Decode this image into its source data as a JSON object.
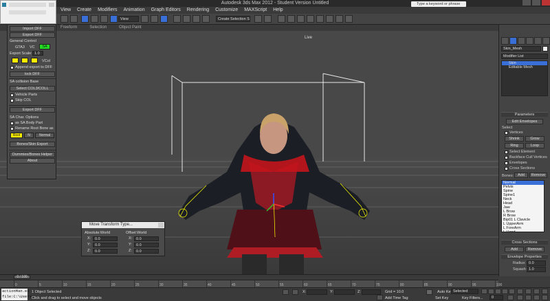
{
  "window": {
    "title": "Autodesk 3ds Max 2012 - Student Version   Untitled"
  },
  "menu": [
    "View",
    "Create",
    "Modifiers",
    "Animation",
    "Graph Editors",
    "Rendering",
    "Customize",
    "MAXScript",
    "Help"
  ],
  "toolbar": {
    "view_select": "View",
    "selection_set": "Create Selection S",
    "search_placeholder": "Type a keyword or phrase"
  },
  "ribbon": [
    "Freeform",
    "Selection",
    "Object Paint"
  ],
  "viewport": {
    "label": "Live"
  },
  "floater": {
    "buttons": {
      "import": "Import DFF",
      "export": "Export DFF",
      "lock": "lock DFF",
      "select_col": "Select COL3/COLL",
      "export2": "Export DFF",
      "bones_export": "Bones/Skin Export",
      "dummies": "Dummies/Bones Helper",
      "about": "About"
    },
    "general_control": "General Control",
    "gta_labels": [
      "GTA3",
      "VC",
      "SA"
    ],
    "export_scale_label": "Export Scale:",
    "export_scale_value": "1.0",
    "vcol_label": "VCol",
    "append": "Append export to DFF",
    "sa_collision": "SA collision Base",
    "vehicle_parts": "Vehicle Parts",
    "skip_col": "Skip COL",
    "sa_char": "SA Char. Options",
    "as_body": "as SA Body Part",
    "rename_root": "Rename Root Bone as",
    "root_fields": [
      "Root",
      "N",
      "Normal"
    ]
  },
  "transform": {
    "title": "Move Transform Type...",
    "absolute": "Absolute:World",
    "offset": "Offset:World",
    "axes": [
      "X:",
      "Y:",
      "Z:"
    ],
    "values": [
      "0.0",
      "0.0",
      "0.0"
    ]
  },
  "command_panel": {
    "object_name": "Skin_Mesh",
    "modifier_list": "Modifier List",
    "stack": [
      "Skin",
      "Editable Mesh"
    ],
    "parameters": "Parameters",
    "edit_envelopes": "Edit Envelopes",
    "select": "Select",
    "vertices": "Vertices",
    "buttons": [
      "Shrink",
      "Grow",
      "Ring",
      "Loop"
    ],
    "select_element": "Select Element",
    "backface": "Backface Cull Vertices",
    "envelopes": "Envelopes",
    "cross_sections": "Cross Sections",
    "bones_label": "Bones:",
    "add": "Add",
    "remove": "Remove",
    "bones": [
      "Normal",
      "Pelvis",
      "Spine",
      "Spine1",
      "Neck",
      "Head",
      "Jaw",
      "L Brow",
      "R Brow",
      "Bip01 L Clavicle",
      "L UpperArm",
      "L ForeArm",
      "L Hand",
      "L Finger"
    ],
    "cross_sections_title": "Cross Sections",
    "cs_add": "Add",
    "cs_remove": "Remove",
    "envelope_props": "Envelope Properties",
    "radius": "Radius:",
    "squash": "Squash:",
    "radius_value": "0.0",
    "squash_value": "1.0"
  },
  "timeline": {
    "slider": "0 / 100",
    "ticks": [
      "0",
      "5",
      "10",
      "15",
      "20",
      "25",
      "30",
      "35",
      "40",
      "45",
      "50",
      "55",
      "60",
      "65",
      "70",
      "75",
      "80",
      "85",
      "90",
      "95",
      "100"
    ]
  },
  "status": {
    "script_line1": "actionMan.ex",
    "script_line2": "file:C:\\Users",
    "selected": "1 Object Selected",
    "prompt": "Click and drag to select and move objects",
    "coords": [
      "X:",
      "Y:",
      "Z:"
    ],
    "grid": "Grid = 10.0",
    "auto_key": "Auto Key",
    "set_key": "Set Key",
    "selected_drop": "Selected",
    "key_filters": "Key Filters...",
    "add_time_tag": "Add Time Tag",
    "frame": "0"
  }
}
